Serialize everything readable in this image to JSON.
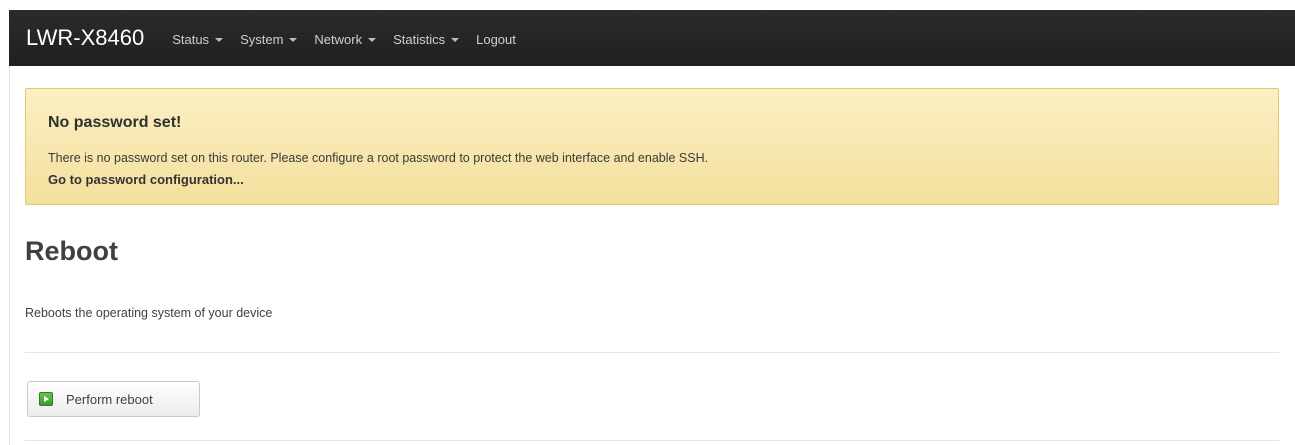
{
  "navbar": {
    "brand": "LWR-X8460",
    "menu": [
      {
        "label": "Status",
        "has_dropdown": true
      },
      {
        "label": "System",
        "has_dropdown": true
      },
      {
        "label": "Network",
        "has_dropdown": true
      },
      {
        "label": "Statistics",
        "has_dropdown": true
      },
      {
        "label": "Logout",
        "has_dropdown": false
      }
    ]
  },
  "alert": {
    "title": "No password set!",
    "text": "There is no password set on this router. Please configure a root password to protect the web interface and enable SSH.",
    "link": "Go to password configuration..."
  },
  "main": {
    "title": "Reboot",
    "description": "Reboots the operating system of your device",
    "reboot_button": {
      "label": "Perform reboot",
      "icon": "play-icon"
    }
  },
  "colors": {
    "navbar_bg": "#222222",
    "alert_bg": "#f7e7a8",
    "alert_border": "#e2c873",
    "icon_green": "#4caf3a"
  }
}
